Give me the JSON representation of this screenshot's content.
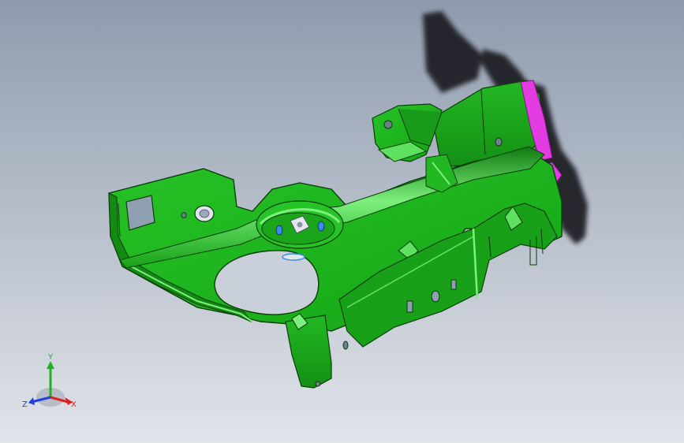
{
  "viewport": {
    "background_top": "#8f9bad",
    "background_bottom": "#e1e4e9"
  },
  "model": {
    "body_color": "#1fb51f",
    "highlight_color": "#7df07d",
    "edge_color": "#0b3d0b",
    "selected_face_color": "#e23ce2",
    "fastener_color": "#3b8ce8",
    "shadow_color": "#1a1d22"
  },
  "triad": {
    "x_label": "X",
    "y_label": "Y",
    "z_label": "Z",
    "x_color": "#e02020",
    "y_color": "#20b020",
    "z_color": "#2040e0"
  }
}
